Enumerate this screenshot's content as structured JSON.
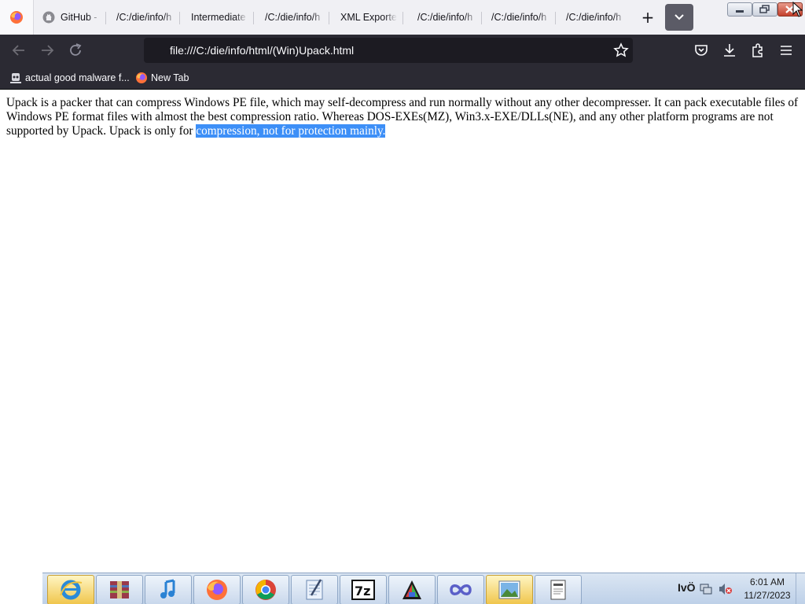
{
  "browser": {
    "tabs": [
      {
        "label": "GitHub -",
        "icon": "github-icon"
      },
      {
        "label": "/C:/die/info/h",
        "icon": "page-icon"
      },
      {
        "label": "Intermediate",
        "icon": "page-icon"
      },
      {
        "label": "/C:/die/info/h",
        "icon": "page-icon"
      },
      {
        "label": "XML Exporter",
        "icon": "page-icon"
      },
      {
        "label": "/C:/die/info/h",
        "icon": "page-icon"
      },
      {
        "label": "/C:/die/info/h",
        "icon": "page-icon"
      },
      {
        "label": "/C:/die/info/h",
        "icon": "page-icon"
      }
    ],
    "new_tab_glyph": "+",
    "url": "file:///C:/die/info/html/(Win)Upack.html",
    "bookmarks": [
      {
        "label": "actual good malware f...",
        "icon": "malware-folder-icon"
      },
      {
        "label": "New Tab",
        "icon": "firefox-icon"
      }
    ]
  },
  "page": {
    "paragraph_before": "Upack is a packer that can compress Windows PE file, which may self-decompress and run normally without any other decompresser. It can pack executable files of Windows PE format files with almost the best compression ratio. Whereas DOS-EXEs(MZ), Win3.x-EXE/DLLs(NE), and any other platform programs are not supported by Upack. Upack is only for ",
    "paragraph_selected": "compression, not for protection mainly."
  },
  "taskbar": {
    "apps": [
      {
        "name": "internet-explorer-icon",
        "active": true
      },
      {
        "name": "archive-app-icon"
      },
      {
        "name": "music-app-icon"
      },
      {
        "name": "firefox-icon"
      },
      {
        "name": "chrome-icon"
      },
      {
        "name": "notepad-icon"
      },
      {
        "name": "7zip-icon"
      },
      {
        "name": "paint-app-icon"
      },
      {
        "name": "infinity-app-icon"
      },
      {
        "name": "photo-viewer-icon",
        "active": true
      },
      {
        "name": "document-icon"
      }
    ],
    "tray_text": "IvÖ",
    "time": "6:01 AM",
    "date": "11/27/2023"
  },
  "colors": {
    "toolbar_bg": "#2b2a33",
    "url_bg": "#1c1b22",
    "selection": "#3d8ff7"
  }
}
